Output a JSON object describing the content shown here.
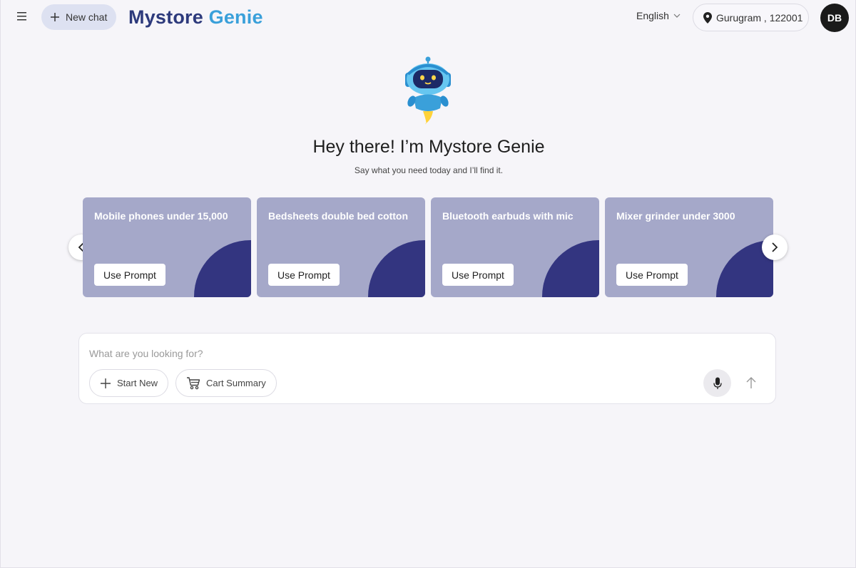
{
  "header": {
    "menu_icon": "hamburger-icon",
    "new_chat_label": "New chat",
    "logo_part1": "Mystore",
    "logo_part2": "Genie",
    "language": "English",
    "location": "Gurugram , 122001",
    "avatar_initials": "DB"
  },
  "hero": {
    "title": "Hey there! I’m Mystore Genie",
    "subtitle": "Say what you need today and I’ll find it."
  },
  "prompts": [
    {
      "title": "Mobile phones under 15,000",
      "button": "Use Prompt"
    },
    {
      "title": "Bedsheets double bed cotton",
      "button": "Use Prompt"
    },
    {
      "title": "Bluetooth earbuds with mic",
      "button": "Use Prompt"
    },
    {
      "title": "Mixer grinder under 3000",
      "button": "Use Prompt"
    }
  ],
  "composer": {
    "placeholder": "What are you looking for?",
    "start_new_label": "Start New",
    "cart_summary_label": "Cart Summary"
  },
  "colors": {
    "brand_dark": "#2d3a7c",
    "brand_light": "#3aa0da",
    "card_bg": "#a5a8c9",
    "card_accent": "#333580"
  }
}
